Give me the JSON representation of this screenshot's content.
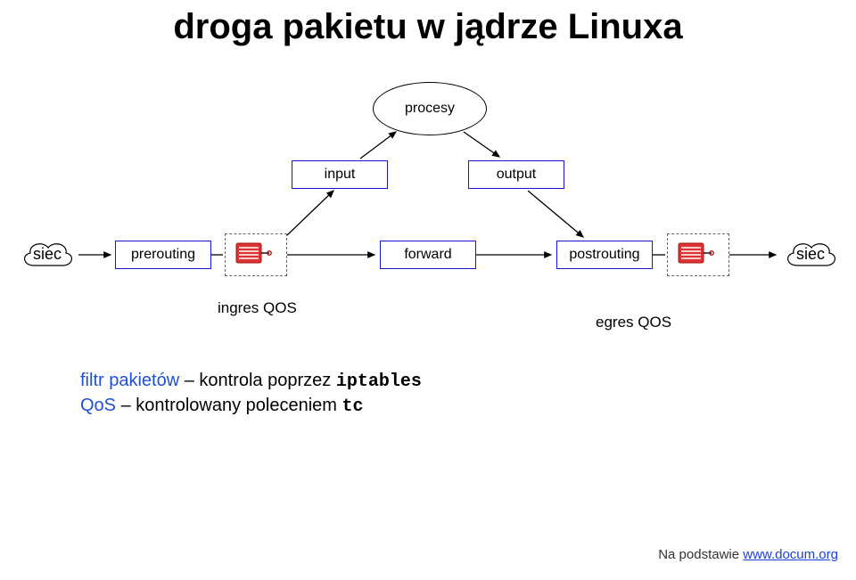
{
  "title": "droga pakietu w jądrze Linuxa",
  "nodes": {
    "procesy": "procesy",
    "input": "input",
    "output": "output",
    "prerouting": "prerouting",
    "forward": "forward",
    "postrouting": "postrouting",
    "siec_left": "siec",
    "siec_right": "siec",
    "ingres_qos": "ingres QOS",
    "egres_qos": "egres QOS"
  },
  "desc": {
    "line1_a": "filtr pakietów",
    "line1_b": " – kontrola poprzez ",
    "line1_c": "iptables",
    "line2_a": "QoS",
    "line2_b": " – kontrolowany poleceniem ",
    "line2_c": "tc"
  },
  "footer": {
    "prefix": "Na podstawie ",
    "link": "www.docum.org"
  }
}
